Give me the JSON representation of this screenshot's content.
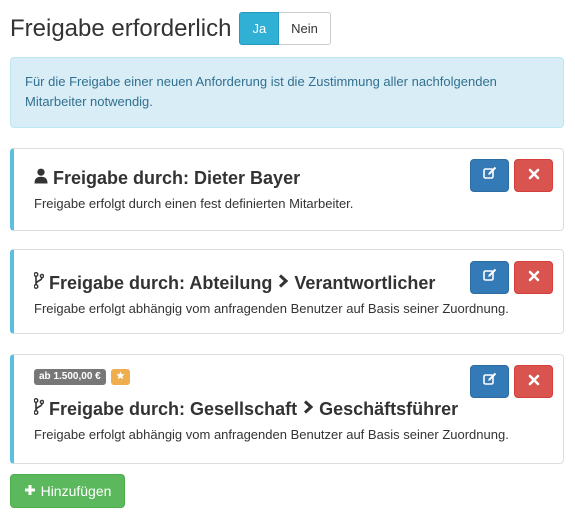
{
  "header": {
    "title": "Freigabe erforderlich",
    "toggle": {
      "yes_label": "Ja",
      "no_label": "Nein",
      "selected": "Ja"
    }
  },
  "info": {
    "text": "Für die Freigabe einer neuen Anforderung ist die Zustimmung aller nachfolgenden Mitarbeiter notwendig."
  },
  "approvals": [
    {
      "icon": "user-icon",
      "title_prefix": "Freigabe durch: Dieter Bayer",
      "description": "Freigabe erfolgt durch einen fest definierten Mitarbeiter."
    },
    {
      "icon": "branch-icon",
      "title_prefix": "Freigabe durch: Abteilung",
      "title_suffix": "Verantwortlicher",
      "description": "Freigabe erfolgt abhängig vom anfragenden Benutzer auf Basis seiner Zuordnung."
    },
    {
      "icon": "branch-icon",
      "badge": "ab 1.500,00 €",
      "badge_star": "star-icon",
      "title_prefix": "Freigabe durch: Gesellschaft",
      "title_suffix": "Geschäftsführer",
      "description": "Freigabe erfolgt abhängig vom anfragenden Benutzer auf Basis seiner Zuordnung."
    }
  ],
  "actions": {
    "edit_icon": "edit-icon",
    "delete_icon": "close-icon"
  },
  "add_button": {
    "label": "Hinzufügen",
    "icon": "plus-icon"
  },
  "colors": {
    "info_accent": "#5bc0de",
    "toggle_active": "#31b0d5",
    "edit": "#337ab7",
    "delete": "#d9534f",
    "add": "#5cb85c",
    "badge": "#777777",
    "star": "#f0ad4e"
  }
}
